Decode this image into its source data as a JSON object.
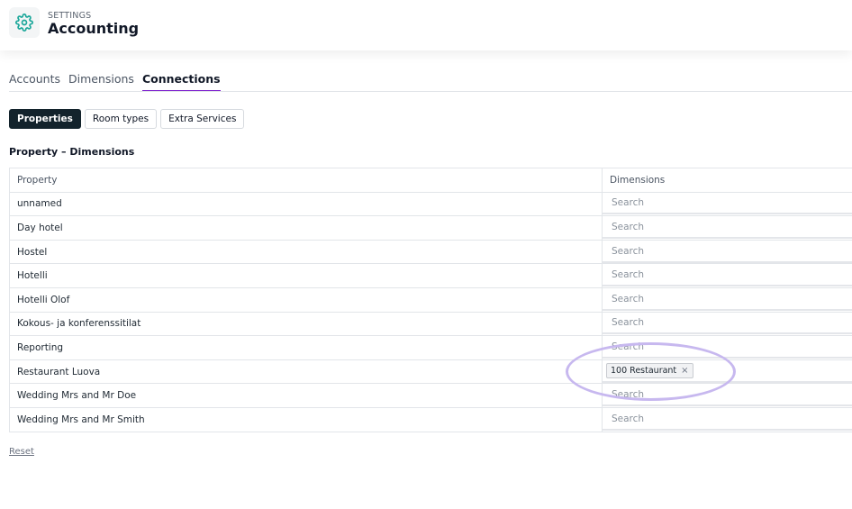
{
  "header": {
    "icon": "gear-icon",
    "overline": "SETTINGS",
    "title": "Accounting",
    "accent_color": "#1aa79a"
  },
  "tabs": [
    {
      "label": "Accounts",
      "active": false
    },
    {
      "label": "Dimensions",
      "active": false
    },
    {
      "label": "Connections",
      "active": true
    }
  ],
  "tab_active_color": "#7e22ce",
  "subtabs": [
    {
      "label": "Properties",
      "active": true
    },
    {
      "label": "Room types",
      "active": false
    },
    {
      "label": "Extra Services",
      "active": false
    }
  ],
  "section_title": "Property – Dimensions",
  "table": {
    "headers": {
      "property": "Property",
      "dimensions": "Dimensions"
    },
    "search_placeholder": "Search",
    "rows": [
      {
        "property": "unnamed",
        "chip": null
      },
      {
        "property": "Day hotel",
        "chip": null
      },
      {
        "property": "Hostel",
        "chip": null
      },
      {
        "property": "Hotelli",
        "chip": null
      },
      {
        "property": "Hotelli Olof",
        "chip": null
      },
      {
        "property": "Kokous- ja konferenssitilat",
        "chip": null
      },
      {
        "property": "Reporting",
        "chip": null
      },
      {
        "property": "Restaurant Luova",
        "chip": "100 Restaurant"
      },
      {
        "property": "Wedding Mrs and Mr Doe",
        "chip": null
      },
      {
        "property": "Wedding Mrs and Mr Smith",
        "chip": null
      }
    ]
  },
  "chip_remove_glyph": "×",
  "reset_label": "Reset",
  "highlight_color": "#c7b8ef"
}
